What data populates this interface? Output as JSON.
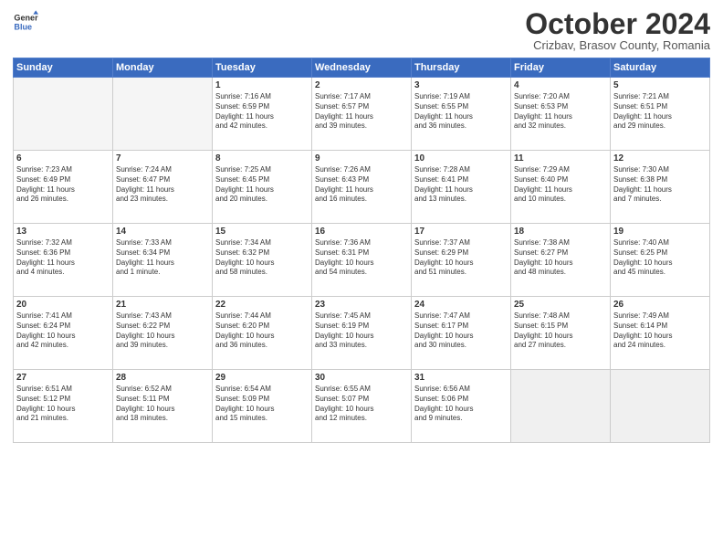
{
  "header": {
    "logo_general": "General",
    "logo_blue": "Blue",
    "month": "October 2024",
    "location": "Crizbav, Brasov County, Romania"
  },
  "weekdays": [
    "Sunday",
    "Monday",
    "Tuesday",
    "Wednesday",
    "Thursday",
    "Friday",
    "Saturday"
  ],
  "rows": [
    [
      {
        "day": "",
        "lines": [],
        "empty": true
      },
      {
        "day": "",
        "lines": [],
        "empty": true
      },
      {
        "day": "1",
        "lines": [
          "Sunrise: 7:16 AM",
          "Sunset: 6:59 PM",
          "Daylight: 11 hours",
          "and 42 minutes."
        ]
      },
      {
        "day": "2",
        "lines": [
          "Sunrise: 7:17 AM",
          "Sunset: 6:57 PM",
          "Daylight: 11 hours",
          "and 39 minutes."
        ]
      },
      {
        "day": "3",
        "lines": [
          "Sunrise: 7:19 AM",
          "Sunset: 6:55 PM",
          "Daylight: 11 hours",
          "and 36 minutes."
        ]
      },
      {
        "day": "4",
        "lines": [
          "Sunrise: 7:20 AM",
          "Sunset: 6:53 PM",
          "Daylight: 11 hours",
          "and 32 minutes."
        ]
      },
      {
        "day": "5",
        "lines": [
          "Sunrise: 7:21 AM",
          "Sunset: 6:51 PM",
          "Daylight: 11 hours",
          "and 29 minutes."
        ]
      }
    ],
    [
      {
        "day": "6",
        "lines": [
          "Sunrise: 7:23 AM",
          "Sunset: 6:49 PM",
          "Daylight: 11 hours",
          "and 26 minutes."
        ]
      },
      {
        "day": "7",
        "lines": [
          "Sunrise: 7:24 AM",
          "Sunset: 6:47 PM",
          "Daylight: 11 hours",
          "and 23 minutes."
        ]
      },
      {
        "day": "8",
        "lines": [
          "Sunrise: 7:25 AM",
          "Sunset: 6:45 PM",
          "Daylight: 11 hours",
          "and 20 minutes."
        ]
      },
      {
        "day": "9",
        "lines": [
          "Sunrise: 7:26 AM",
          "Sunset: 6:43 PM",
          "Daylight: 11 hours",
          "and 16 minutes."
        ]
      },
      {
        "day": "10",
        "lines": [
          "Sunrise: 7:28 AM",
          "Sunset: 6:41 PM",
          "Daylight: 11 hours",
          "and 13 minutes."
        ]
      },
      {
        "day": "11",
        "lines": [
          "Sunrise: 7:29 AM",
          "Sunset: 6:40 PM",
          "Daylight: 11 hours",
          "and 10 minutes."
        ]
      },
      {
        "day": "12",
        "lines": [
          "Sunrise: 7:30 AM",
          "Sunset: 6:38 PM",
          "Daylight: 11 hours",
          "and 7 minutes."
        ]
      }
    ],
    [
      {
        "day": "13",
        "lines": [
          "Sunrise: 7:32 AM",
          "Sunset: 6:36 PM",
          "Daylight: 11 hours",
          "and 4 minutes."
        ]
      },
      {
        "day": "14",
        "lines": [
          "Sunrise: 7:33 AM",
          "Sunset: 6:34 PM",
          "Daylight: 11 hours",
          "and 1 minute."
        ]
      },
      {
        "day": "15",
        "lines": [
          "Sunrise: 7:34 AM",
          "Sunset: 6:32 PM",
          "Daylight: 10 hours",
          "and 58 minutes."
        ]
      },
      {
        "day": "16",
        "lines": [
          "Sunrise: 7:36 AM",
          "Sunset: 6:31 PM",
          "Daylight: 10 hours",
          "and 54 minutes."
        ]
      },
      {
        "day": "17",
        "lines": [
          "Sunrise: 7:37 AM",
          "Sunset: 6:29 PM",
          "Daylight: 10 hours",
          "and 51 minutes."
        ]
      },
      {
        "day": "18",
        "lines": [
          "Sunrise: 7:38 AM",
          "Sunset: 6:27 PM",
          "Daylight: 10 hours",
          "and 48 minutes."
        ]
      },
      {
        "day": "19",
        "lines": [
          "Sunrise: 7:40 AM",
          "Sunset: 6:25 PM",
          "Daylight: 10 hours",
          "and 45 minutes."
        ]
      }
    ],
    [
      {
        "day": "20",
        "lines": [
          "Sunrise: 7:41 AM",
          "Sunset: 6:24 PM",
          "Daylight: 10 hours",
          "and 42 minutes."
        ]
      },
      {
        "day": "21",
        "lines": [
          "Sunrise: 7:43 AM",
          "Sunset: 6:22 PM",
          "Daylight: 10 hours",
          "and 39 minutes."
        ]
      },
      {
        "day": "22",
        "lines": [
          "Sunrise: 7:44 AM",
          "Sunset: 6:20 PM",
          "Daylight: 10 hours",
          "and 36 minutes."
        ]
      },
      {
        "day": "23",
        "lines": [
          "Sunrise: 7:45 AM",
          "Sunset: 6:19 PM",
          "Daylight: 10 hours",
          "and 33 minutes."
        ]
      },
      {
        "day": "24",
        "lines": [
          "Sunrise: 7:47 AM",
          "Sunset: 6:17 PM",
          "Daylight: 10 hours",
          "and 30 minutes."
        ]
      },
      {
        "day": "25",
        "lines": [
          "Sunrise: 7:48 AM",
          "Sunset: 6:15 PM",
          "Daylight: 10 hours",
          "and 27 minutes."
        ]
      },
      {
        "day": "26",
        "lines": [
          "Sunrise: 7:49 AM",
          "Sunset: 6:14 PM",
          "Daylight: 10 hours",
          "and 24 minutes."
        ]
      }
    ],
    [
      {
        "day": "27",
        "lines": [
          "Sunrise: 6:51 AM",
          "Sunset: 5:12 PM",
          "Daylight: 10 hours",
          "and 21 minutes."
        ]
      },
      {
        "day": "28",
        "lines": [
          "Sunrise: 6:52 AM",
          "Sunset: 5:11 PM",
          "Daylight: 10 hours",
          "and 18 minutes."
        ]
      },
      {
        "day": "29",
        "lines": [
          "Sunrise: 6:54 AM",
          "Sunset: 5:09 PM",
          "Daylight: 10 hours",
          "and 15 minutes."
        ]
      },
      {
        "day": "30",
        "lines": [
          "Sunrise: 6:55 AM",
          "Sunset: 5:07 PM",
          "Daylight: 10 hours",
          "and 12 minutes."
        ]
      },
      {
        "day": "31",
        "lines": [
          "Sunrise: 6:56 AM",
          "Sunset: 5:06 PM",
          "Daylight: 10 hours",
          "and 9 minutes."
        ]
      },
      {
        "day": "",
        "lines": [],
        "empty": true,
        "shaded": true
      },
      {
        "day": "",
        "lines": [],
        "empty": true,
        "shaded": true
      }
    ]
  ]
}
